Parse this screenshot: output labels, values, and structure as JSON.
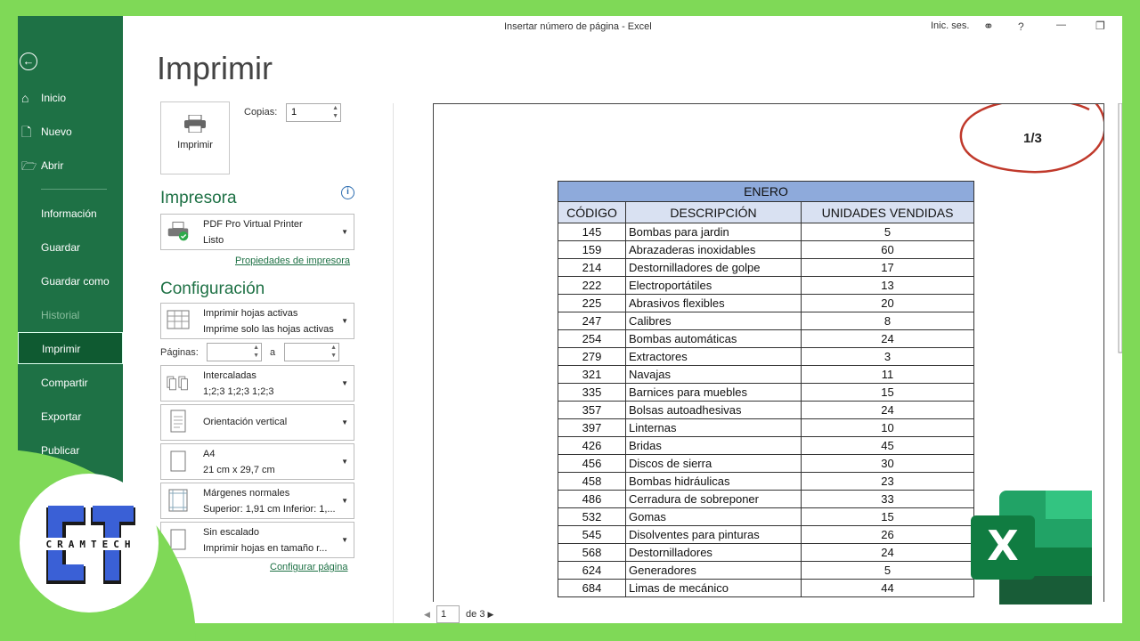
{
  "window": {
    "doc_title": "Insertar número de página  -  Excel",
    "signin": "Inic. ses.",
    "help": "?",
    "minimize": "—",
    "restore": "❐"
  },
  "sidebar": {
    "back_icon": "back-arrow-icon",
    "items": [
      {
        "label": "Inicio",
        "icon": "home-icon"
      },
      {
        "label": "Nuevo",
        "icon": "new-document-icon"
      },
      {
        "label": "Abrir",
        "icon": "folder-open-icon"
      },
      {
        "label": "Información"
      },
      {
        "label": "Guardar"
      },
      {
        "label": "Guardar como"
      },
      {
        "label": "Historial"
      },
      {
        "label": "Imprimir"
      },
      {
        "label": "Compartir"
      },
      {
        "label": "Exportar"
      },
      {
        "label": "Publicar"
      }
    ]
  },
  "print": {
    "heading": "Imprimir",
    "print_button": "Imprimir",
    "copies_label": "Copias:",
    "copies_value": "1",
    "printer_heading": "Impresora",
    "printer_name": "PDF Pro Virtual Printer",
    "printer_status": "Listo",
    "printer_props_link": "Propiedades de impresora",
    "settings_heading": "Configuración",
    "scope_title": "Imprimir hojas activas",
    "scope_desc": "Imprime solo las hojas activas",
    "pages_label": "Páginas:",
    "pages_to": "a",
    "collate_title": "Intercaladas",
    "collate_desc": "1;2;3    1;2;3    1;2;3",
    "orientation": "Orientación vertical",
    "paper_title": "A4",
    "paper_desc": "21 cm x 29,7 cm",
    "margins_title": "Márgenes normales",
    "margins_desc": "Superior: 1,91 cm Inferior: 1,...",
    "scaling_title": "Sin escalado",
    "scaling_desc": "Imprimir hojas en tamaño r...",
    "page_setup_link": "Configurar página"
  },
  "preview": {
    "page_number": "1/3",
    "table": {
      "month": "ENERO",
      "headers": [
        "CÓDIGO",
        "DESCRIPCIÓN",
        "UNIDADES VENDIDAS"
      ],
      "rows": [
        [
          "145",
          "Bombas para jardin",
          "5"
        ],
        [
          "159",
          "Abrazaderas inoxidables",
          "60"
        ],
        [
          "214",
          "Destornilladores de golpe",
          "17"
        ],
        [
          "222",
          "Electroportátiles",
          "13"
        ],
        [
          "225",
          "Abrasivos flexibles",
          "20"
        ],
        [
          "247",
          "Calibres",
          "8"
        ],
        [
          "254",
          "Bombas automáticas",
          "24"
        ],
        [
          "279",
          "Extractores",
          "3"
        ],
        [
          "321",
          "Navajas",
          "11"
        ],
        [
          "335",
          "Barnices para muebles",
          "15"
        ],
        [
          "357",
          "Bolsas autoadhesivas",
          "24"
        ],
        [
          "397",
          "Linternas",
          "10"
        ],
        [
          "426",
          "Bridas",
          "45"
        ],
        [
          "456",
          "Discos de sierra",
          "30"
        ],
        [
          "458",
          "Bombas hidráulicas",
          "23"
        ],
        [
          "486",
          "Cerradura de sobreponer",
          "33"
        ],
        [
          "532",
          "Gomas",
          "15"
        ],
        [
          "545",
          "Disolventes para pinturas",
          "26"
        ],
        [
          "568",
          "Destornilladores",
          "24"
        ],
        [
          "624",
          "Generadores",
          "5"
        ],
        [
          "684",
          "Limas de mecánico",
          "44"
        ]
      ]
    },
    "pager": {
      "current": "1",
      "total": "de 3"
    }
  },
  "overlays": {
    "ct_logo_text": "CRAMTECH",
    "ct_logo_letters": "CT",
    "excel_logo_letter": "X",
    "annotation_color": "#c0392b"
  }
}
